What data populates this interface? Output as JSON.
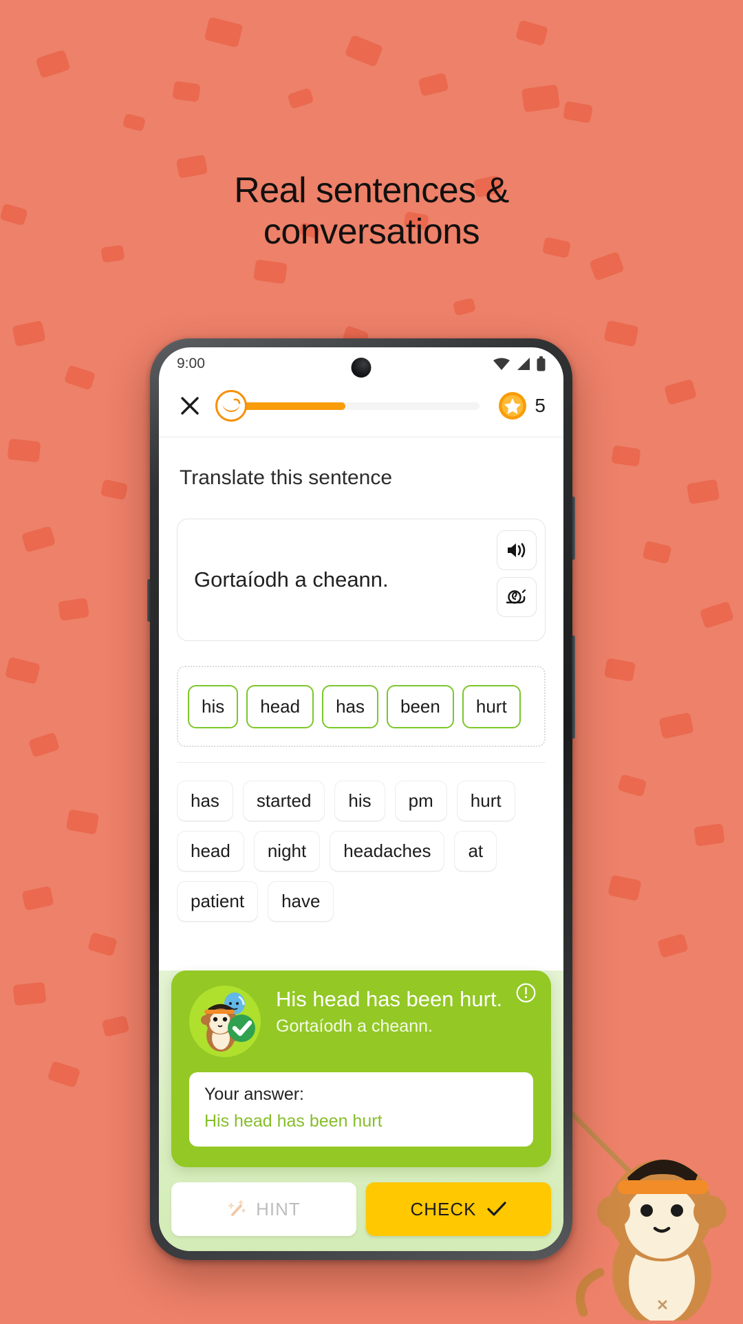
{
  "page": {
    "headline_line1": "Real sentences &",
    "headline_line2": "conversations",
    "bg_color": "#ED8169",
    "confetti_color": "#E8563A"
  },
  "status_bar": {
    "time": "9:00",
    "icons": [
      "wifi-icon",
      "signal-icon",
      "battery-icon"
    ]
  },
  "exercise_header": {
    "close_icon": "close-icon",
    "mascot_icon": "monkey-face-icon",
    "progress_percent": 46,
    "progress_fill_color": "#F99C0A",
    "progress_track_color": "#F4F4F4",
    "streak_icon": "star-coin-icon",
    "streak_count": "5"
  },
  "prompt": {
    "title": "Translate this sentence",
    "sentence": "Gortaíodh a cheann.",
    "audio_button_icon": "speaker-icon",
    "slow_audio_button_icon": "snail-icon"
  },
  "answer": {
    "selected_words": [
      "his",
      "head",
      "has",
      "been",
      "hurt"
    ],
    "selected_border_color": "#7CC62A"
  },
  "word_bank": {
    "words": [
      "has",
      "started",
      "his",
      "pm",
      "hurt",
      "head",
      "night",
      "headaches",
      "at",
      "patient",
      "have"
    ]
  },
  "feedback": {
    "panel_color": "#93C825",
    "avatar_icon": "monkey-with-balloon-icon",
    "check_icon": "check-circle-icon",
    "info_icon": "info-icon",
    "correct_answer": "His head has been hurt.",
    "translation": "Gortaíodh a cheann.",
    "your_answer_label": "Your answer:",
    "your_answer_value": "His head has been hurt",
    "your_answer_color": "#86BE2A"
  },
  "buttons": {
    "hint_label": "HINT",
    "hint_icon": "magic-wand-icon",
    "check_label": "CHECK",
    "check_icon": "checkmark-icon",
    "check_bg": "#FFC800"
  },
  "decoration": {
    "mascot_icon": "monkey-with-pointer-icon"
  }
}
